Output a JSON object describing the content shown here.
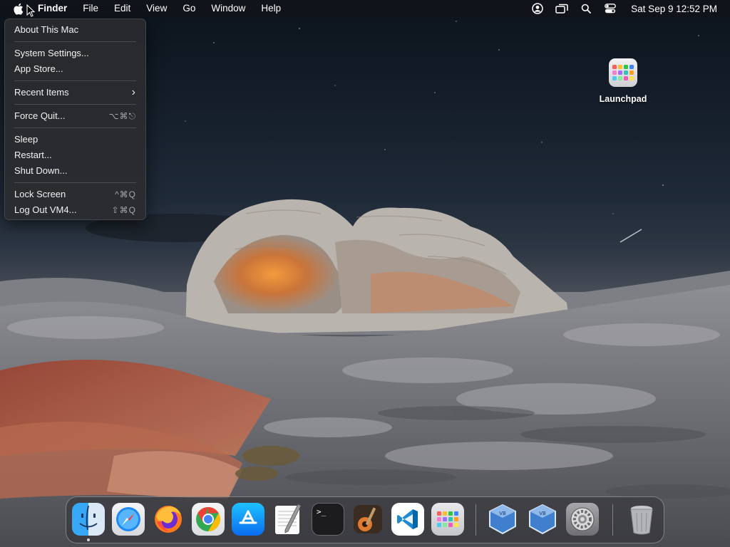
{
  "menubar": {
    "app_name": "Finder",
    "menus": [
      "File",
      "Edit",
      "View",
      "Go",
      "Window",
      "Help"
    ],
    "clock": "Sat Sep 9  12:52 PM",
    "status_icons": [
      "user-icon",
      "screen-mirroring-icon",
      "search-icon",
      "control-center-icon"
    ]
  },
  "apple_menu": {
    "items": [
      {
        "label": "About This Mac"
      },
      {
        "label": "System Settings..."
      },
      {
        "label": "App Store..."
      },
      {
        "label": "Recent Items",
        "submenu_arrow": "›"
      },
      {
        "label": "Force Quit...",
        "shortcut": "⌥⌘⎋"
      },
      {
        "label": "Sleep"
      },
      {
        "label": "Restart..."
      },
      {
        "label": "Shut Down..."
      },
      {
        "label": "Lock Screen",
        "shortcut": "^⌘Q"
      },
      {
        "label": "Log Out VM4...",
        "shortcut": "⇧⌘Q"
      }
    ]
  },
  "desktop": {
    "icons": [
      {
        "label": "Launchpad",
        "icon": "launchpad-icon"
      }
    ]
  },
  "dock": {
    "apps": [
      {
        "name": "Finder",
        "icon": "finder-icon",
        "running": true
      },
      {
        "name": "Safari",
        "icon": "safari-icon"
      },
      {
        "name": "Firefox",
        "icon": "firefox-icon"
      },
      {
        "name": "Chrome",
        "icon": "chrome-icon"
      },
      {
        "name": "App Store",
        "icon": "app-store-icon"
      },
      {
        "name": "TextEdit",
        "icon": "textedit-icon"
      },
      {
        "name": "Terminal",
        "icon": "terminal-icon",
        "glyph": ">_"
      },
      {
        "name": "GarageBand",
        "icon": "garageband-icon"
      },
      {
        "name": "Visual Studio Code",
        "icon": "vscode-icon"
      },
      {
        "name": "Launchpad",
        "icon": "launchpad-icon"
      },
      {
        "name": "VirtualBox",
        "icon": "virtualbox-icon"
      },
      {
        "name": "VirtualBox VM",
        "icon": "virtualbox-vm-icon"
      },
      {
        "name": "System Settings",
        "icon": "system-settings-icon"
      },
      {
        "name": "Trash",
        "icon": "trash-icon"
      }
    ]
  },
  "colors": {
    "accent": "#0a84ff",
    "menu_bg": "#2c2c30",
    "sky_top": "#0c131c"
  }
}
